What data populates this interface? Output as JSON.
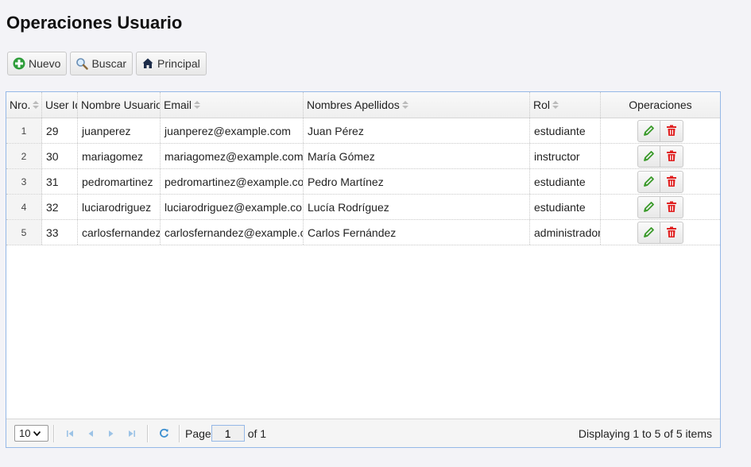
{
  "page": {
    "title": "Operaciones Usuario"
  },
  "toolbar": {
    "buttons": [
      {
        "label": "Nuevo",
        "icon": "add-icon"
      },
      {
        "label": "Buscar",
        "icon": "search-icon"
      },
      {
        "label": "Principal",
        "icon": "home-icon"
      }
    ]
  },
  "grid": {
    "columns": [
      "Nro.",
      "User Id",
      "Nombre Usuario",
      "Email",
      "Nombres Apellidos",
      "Rol",
      "Operaciones"
    ],
    "rows": [
      {
        "nro": "1",
        "user_id": "29",
        "nombre_usuario": "juanperez",
        "email": "juanperez@example.com",
        "nombres_apellidos": "Juan Pérez",
        "rol": "estudiante"
      },
      {
        "nro": "2",
        "user_id": "30",
        "nombre_usuario": "mariagomez",
        "email": "mariagomez@example.com",
        "nombres_apellidos": "María Gómez",
        "rol": "instructor"
      },
      {
        "nro": "3",
        "user_id": "31",
        "nombre_usuario": "pedromartinez",
        "email": "pedromartinez@example.com",
        "nombres_apellidos": "Pedro Martínez",
        "rol": "estudiante"
      },
      {
        "nro": "4",
        "user_id": "32",
        "nombre_usuario": "luciarodriguez",
        "email": "luciarodriguez@example.com",
        "nombres_apellidos": "Lucía Rodríguez",
        "rol": "estudiante"
      },
      {
        "nro": "5",
        "user_id": "33",
        "nombre_usuario": "carlosfernandez",
        "email": "carlosfernandez@example.com",
        "nombres_apellidos": "Carlos Fernández",
        "rol": "administrador"
      }
    ],
    "row_actions": [
      {
        "name": "edit",
        "icon": "pencil-icon",
        "color": "#3a9a2a"
      },
      {
        "name": "delete",
        "icon": "trash-icon",
        "color": "#e02020"
      }
    ]
  },
  "pager": {
    "page_size": "10",
    "page_label": "Page",
    "page_value": "1",
    "of_label": "of 1",
    "info": "Displaying 1 to 5 of 5 items"
  },
  "colors": {
    "border": "#95b8e7",
    "add": "#2e9d3a",
    "home": "#1d2d4a",
    "pager_icons": "#3c8fd0"
  }
}
